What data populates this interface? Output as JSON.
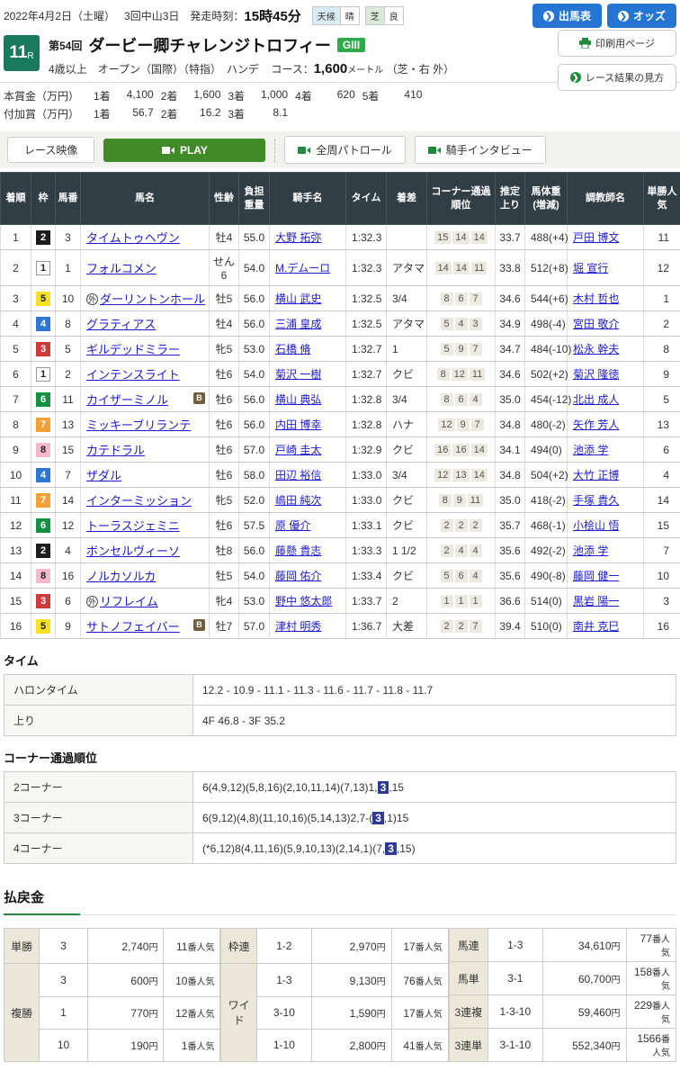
{
  "labels": {
    "yen": "円",
    "pop_suffix": "番人気"
  },
  "header": {
    "date": "2022年4月2日（土曜）",
    "meeting": "3回中山3日",
    "start_label": "発走時刻：",
    "start_time": "15時45分",
    "weather_label": "天候",
    "weather_value": "晴",
    "turf_label": "芝",
    "turf_value": "良",
    "entries_button": "出馬表",
    "odds_button": "オッズ",
    "print_button": "印刷用ページ",
    "guide_button": "レース結果の見方"
  },
  "race": {
    "number": "11",
    "number_suffix": "R",
    "edition": "第54回",
    "title": "ダービー卿チャレンジトロフィー",
    "grade": "GIII",
    "conditions": "4歳以上　オープン（国際）（特指）　ハンデ",
    "course_label": "コース：",
    "course_distance": "1,600",
    "course_unit": "メートル",
    "course_detail": "（芝・右 外）"
  },
  "prize": {
    "main_label": "本賞金（万円）",
    "main_items": [
      {
        "p": "1着",
        "v": "4,100"
      },
      {
        "p": "2着",
        "v": "1,600"
      },
      {
        "p": "3着",
        "v": "1,000"
      },
      {
        "p": "4着",
        "v": "620"
      },
      {
        "p": "5着",
        "v": "410"
      }
    ],
    "added_label": "付加賞（万円）",
    "added_items": [
      {
        "p": "1着",
        "v": "56.7"
      },
      {
        "p": "2着",
        "v": "16.2"
      },
      {
        "p": "3着",
        "v": "8.1"
      }
    ]
  },
  "video": {
    "label": "レース映像",
    "play": "PLAY",
    "patrol": "全周パトロール",
    "interview": "騎手インタビュー"
  },
  "results": {
    "headers": [
      "着順",
      "枠",
      "馬番",
      "馬名",
      "性齢",
      "負担重量",
      "騎手名",
      "タイム",
      "着差",
      "コーナー通過順位",
      "推定上り",
      "馬体重(増減)",
      "調教師名",
      "単勝人気"
    ],
    "rows": [
      {
        "pos": "1",
        "waku": "2",
        "num": "3",
        "mark": "",
        "name": "タイムトゥヘヴン",
        "blinker": "",
        "sexage": "牡4",
        "weight": "55.0",
        "jockey": "大野 拓弥",
        "time": "1:32.3",
        "margin": "",
        "corners": [
          "15",
          "14",
          "14"
        ],
        "agari": "33.7",
        "body": "488(+4)",
        "trainer": "戸田 博文",
        "pop": "11"
      },
      {
        "pos": "2",
        "waku": "1",
        "num": "1",
        "mark": "",
        "name": "フォルコメン",
        "blinker": "",
        "sexage": "せん6",
        "weight": "54.0",
        "jockey": "M.デムーロ",
        "time": "1:32.3",
        "margin": "アタマ",
        "corners": [
          "14",
          "14",
          "11"
        ],
        "agari": "33.8",
        "body": "512(+8)",
        "trainer": "堀 宣行",
        "pop": "12"
      },
      {
        "pos": "3",
        "waku": "5",
        "num": "10",
        "mark": "外",
        "name": "ダーリントンホール",
        "blinker": "",
        "sexage": "牡5",
        "weight": "56.0",
        "jockey": "横山 武史",
        "time": "1:32.5",
        "margin": "3/4",
        "corners": [
          "8",
          "6",
          "7"
        ],
        "agari": "34.6",
        "body": "544(+6)",
        "trainer": "木村 哲也",
        "pop": "1"
      },
      {
        "pos": "4",
        "waku": "4",
        "num": "8",
        "mark": "",
        "name": "グラティアス",
        "blinker": "",
        "sexage": "牡4",
        "weight": "56.0",
        "jockey": "三浦 皇成",
        "time": "1:32.5",
        "margin": "アタマ",
        "corners": [
          "5",
          "4",
          "3"
        ],
        "agari": "34.9",
        "body": "498(-4)",
        "trainer": "宮田 敬介",
        "pop": "2"
      },
      {
        "pos": "5",
        "waku": "3",
        "num": "5",
        "mark": "",
        "name": "ギルデッドミラー",
        "blinker": "",
        "sexage": "牝5",
        "weight": "53.0",
        "jockey": "石橋 脩",
        "time": "1:32.7",
        "margin": "1",
        "corners": [
          "5",
          "9",
          "7"
        ],
        "agari": "34.7",
        "body": "484(-10)",
        "trainer": "松永 幹夫",
        "pop": "8"
      },
      {
        "pos": "6",
        "waku": "1",
        "num": "2",
        "mark": "",
        "name": "インテンスライト",
        "blinker": "",
        "sexage": "牡6",
        "weight": "54.0",
        "jockey": "菊沢 一樹",
        "time": "1:32.7",
        "margin": "クビ",
        "corners": [
          "8",
          "12",
          "11"
        ],
        "agari": "34.6",
        "body": "502(+2)",
        "trainer": "菊沢 隆徳",
        "pop": "9"
      },
      {
        "pos": "7",
        "waku": "6",
        "num": "11",
        "mark": "",
        "name": "カイザーミノル",
        "blinker": "B",
        "sexage": "牡6",
        "weight": "56.0",
        "jockey": "横山 典弘",
        "time": "1:32.8",
        "margin": "3/4",
        "corners": [
          "8",
          "6",
          "4"
        ],
        "agari": "35.0",
        "body": "454(-12)",
        "trainer": "北出 成人",
        "pop": "5"
      },
      {
        "pos": "8",
        "waku": "7",
        "num": "13",
        "mark": "",
        "name": "ミッキーブリランテ",
        "blinker": "",
        "sexage": "牡6",
        "weight": "56.0",
        "jockey": "内田 博幸",
        "time": "1:32.8",
        "margin": "ハナ",
        "corners": [
          "12",
          "9",
          "7"
        ],
        "agari": "34.8",
        "body": "480(-2)",
        "trainer": "矢作 芳人",
        "pop": "13"
      },
      {
        "pos": "9",
        "waku": "8",
        "num": "15",
        "mark": "",
        "name": "カテドラル",
        "blinker": "",
        "sexage": "牡6",
        "weight": "57.0",
        "jockey": "戸崎 圭太",
        "time": "1:32.9",
        "margin": "クビ",
        "corners": [
          "16",
          "16",
          "14"
        ],
        "agari": "34.1",
        "body": "494(0)",
        "trainer": "池添 学",
        "pop": "6"
      },
      {
        "pos": "10",
        "waku": "4",
        "num": "7",
        "mark": "",
        "name": "ザダル",
        "blinker": "",
        "sexage": "牡6",
        "weight": "58.0",
        "jockey": "田辺 裕信",
        "time": "1:33.0",
        "margin": "3/4",
        "corners": [
          "12",
          "13",
          "14"
        ],
        "agari": "34.8",
        "body": "504(+2)",
        "trainer": "大竹 正博",
        "pop": "4"
      },
      {
        "pos": "11",
        "waku": "7",
        "num": "14",
        "mark": "",
        "name": "インターミッション",
        "blinker": "",
        "sexage": "牝5",
        "weight": "52.0",
        "jockey": "嶋田 純次",
        "time": "1:33.0",
        "margin": "クビ",
        "corners": [
          "8",
          "9",
          "11"
        ],
        "agari": "35.0",
        "body": "418(-2)",
        "trainer": "手塚 貴久",
        "pop": "14"
      },
      {
        "pos": "12",
        "waku": "6",
        "num": "12",
        "mark": "",
        "name": "トーラスジェミニ",
        "blinker": "",
        "sexage": "牡6",
        "weight": "57.5",
        "jockey": "原 優介",
        "time": "1:33.1",
        "margin": "クビ",
        "corners": [
          "2",
          "2",
          "2"
        ],
        "agari": "35.7",
        "body": "468(-1)",
        "trainer": "小桧山 悟",
        "pop": "15"
      },
      {
        "pos": "13",
        "waku": "2",
        "num": "4",
        "mark": "",
        "name": "ボンセルヴィーソ",
        "blinker": "",
        "sexage": "牡8",
        "weight": "56.0",
        "jockey": "藤懸 貴志",
        "time": "1:33.3",
        "margin": "1 1/2",
        "corners": [
          "2",
          "4",
          "4"
        ],
        "agari": "35.6",
        "body": "492(-2)",
        "trainer": "池添 学",
        "pop": "7"
      },
      {
        "pos": "14",
        "waku": "8",
        "num": "16",
        "mark": "",
        "name": "ノルカソルカ",
        "blinker": "",
        "sexage": "牡5",
        "weight": "54.0",
        "jockey": "藤岡 佑介",
        "time": "1:33.4",
        "margin": "クビ",
        "corners": [
          "5",
          "6",
          "4"
        ],
        "agari": "35.6",
        "body": "490(-8)",
        "trainer": "藤岡 健一",
        "pop": "10"
      },
      {
        "pos": "15",
        "waku": "3",
        "num": "6",
        "mark": "外",
        "name": "リフレイム",
        "blinker": "",
        "sexage": "牝4",
        "weight": "53.0",
        "jockey": "野中 悠太郎",
        "time": "1:33.7",
        "margin": "2",
        "corners": [
          "1",
          "1",
          "1"
        ],
        "agari": "36.6",
        "body": "514(0)",
        "trainer": "黒岩 陽一",
        "pop": "3"
      },
      {
        "pos": "16",
        "waku": "5",
        "num": "9",
        "mark": "",
        "name": "サトノフェイバー",
        "blinker": "B",
        "sexage": "牡7",
        "weight": "57.0",
        "jockey": "津村 明秀",
        "time": "1:36.7",
        "margin": "大差",
        "corners": [
          "2",
          "2",
          "7"
        ],
        "agari": "39.4",
        "body": "510(0)",
        "trainer": "南井 克巳",
        "pop": "16"
      }
    ]
  },
  "time_section": {
    "title": "タイム",
    "rows": [
      {
        "label": "ハロンタイム",
        "value": "12.2 - 10.9 - 11.1 - 11.3 - 11.6 - 11.7 - 11.8 - 11.7"
      },
      {
        "label": "上り",
        "value": "4F 46.8 - 3F 35.2"
      }
    ]
  },
  "corner_section": {
    "title": "コーナー通過順位",
    "rows": [
      {
        "label": "2コーナー",
        "pre": "6(4,9,12)(5,8,16)(2,10,11,14)(7,13)1,",
        "hl": "3",
        "post": ",15"
      },
      {
        "label": "3コーナー",
        "pre": "6(9,12)(4,8)(11,10,16)(5,14,13)2,7-(",
        "hl": "3",
        "post": ",1)15"
      },
      {
        "label": "4コーナー",
        "pre": "(*6,12)8(4,11,16)(5,9,10,13)(2,14,1)(7,",
        "hl": "3",
        "post": ",15)"
      }
    ]
  },
  "payout": {
    "title": "払戻金",
    "win": {
      "label": "単勝",
      "combo": "3",
      "amount": "2,740",
      "pop": "11"
    },
    "place": {
      "label": "複勝",
      "rows": [
        {
          "combo": "3",
          "amount": "600",
          "pop": "10"
        },
        {
          "combo": "1",
          "amount": "770",
          "pop": "12"
        },
        {
          "combo": "10",
          "amount": "190",
          "pop": "1"
        }
      ]
    },
    "wakuren": {
      "label": "枠連",
      "combo": "1-2",
      "amount": "2,970",
      "pop": "17"
    },
    "wide": {
      "label": "ワイド",
      "rows": [
        {
          "combo": "1-3",
          "amount": "9,130",
          "pop": "76"
        },
        {
          "combo": "3-10",
          "amount": "1,590",
          "pop": "17"
        },
        {
          "combo": "1-10",
          "amount": "2,800",
          "pop": "41"
        }
      ]
    },
    "umaren": {
      "label": "馬連",
      "combo": "1-3",
      "amount": "34,610",
      "pop": "77"
    },
    "umatan": {
      "label": "馬単",
      "combo": "3-1",
      "amount": "60,700",
      "pop": "158"
    },
    "sanfuku": {
      "label": "3連複",
      "combo": "1-3-10",
      "amount": "59,460",
      "pop": "229"
    },
    "santan": {
      "label": "3連単",
      "combo": "3-1-10",
      "amount": "552,340",
      "pop": "1566"
    }
  }
}
